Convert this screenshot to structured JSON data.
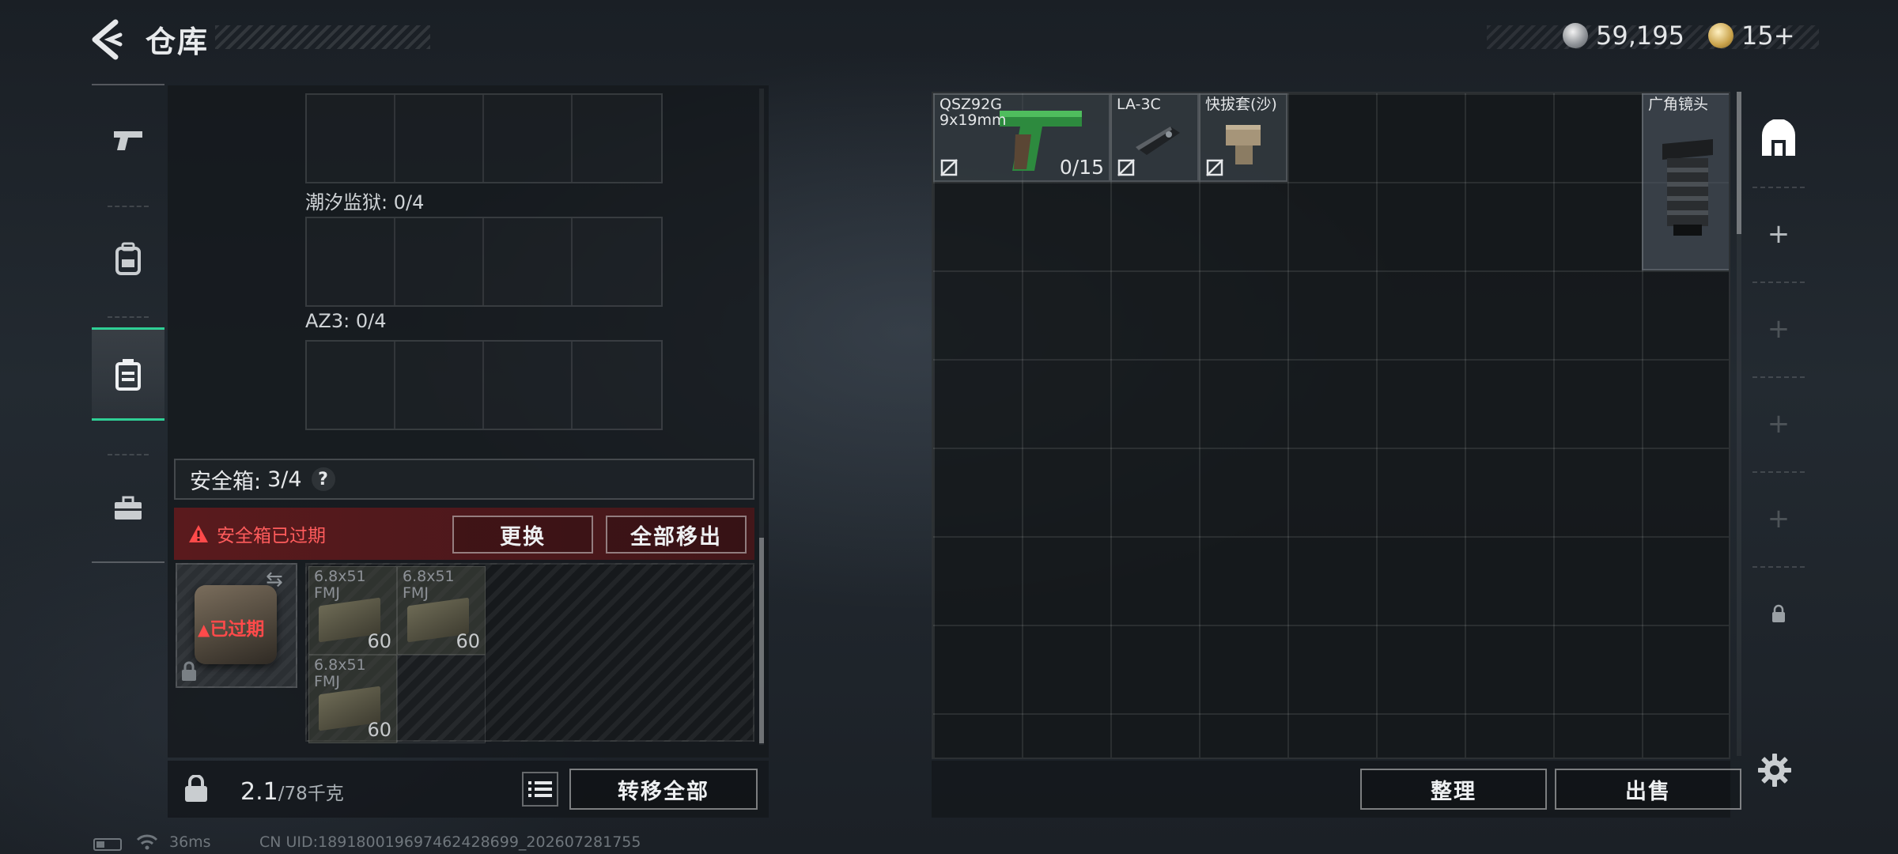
{
  "header": {
    "title": "仓库",
    "currency_silver": "59,195",
    "currency_gold": "15+"
  },
  "nav": {
    "items": [
      {
        "icon": "pistol-icon"
      },
      {
        "icon": "backpack-icon"
      },
      {
        "icon": "safe-box-icon",
        "active": true
      },
      {
        "icon": "briefcase-icon"
      }
    ]
  },
  "left_panel": {
    "slot_groups": [
      {
        "label": ""
      },
      {
        "label": "潮汐监狱: 0/4"
      },
      {
        "label": "AZ3: 0/4"
      }
    ],
    "safe_box": {
      "label": "安全箱:",
      "count": "3/4",
      "help": "?",
      "expired_warning": "安全箱已过期",
      "btn_replace": "更换",
      "btn_remove_all": "全部移出",
      "case_status": "已过期",
      "ammo": [
        {
          "name": "6.8x51 FMJ",
          "name_line1": "6.8x51",
          "name_line2": "FMJ",
          "count": "60"
        },
        {
          "name": "6.8x51 FMJ",
          "name_line1": "6.8x51",
          "name_line2": "FMJ",
          "count": "60"
        },
        {
          "name": "6.8x51 FMJ",
          "name_line1": "6.8x51",
          "name_line2": "FMJ",
          "count": "60"
        }
      ]
    },
    "weight": {
      "current": "2.1",
      "capacity": "/78千克"
    },
    "btn_transfer_all": "转移全部"
  },
  "stash": {
    "items": [
      {
        "name_line1": "QSZ92G",
        "name_line2": "9x19mm",
        "count": "0/15"
      },
      {
        "name_line1": "LA-3C"
      },
      {
        "name_line1": "快拔套(沙)"
      },
      {
        "name_line1": "广角镜头"
      }
    ],
    "btn_sort": "整理",
    "btn_sell": "出售"
  },
  "side_tabs": [
    "home-icon",
    "+",
    "+",
    "+",
    "+",
    "lock-icon"
  ],
  "status": {
    "ping": "36ms",
    "uid": "CN UID:18918001969746242869​9_202607281755"
  },
  "colors": {
    "accent_green": "#2fcf95",
    "warning_red": "#ff4a4a",
    "expired_bg": "#5a1a1d"
  }
}
